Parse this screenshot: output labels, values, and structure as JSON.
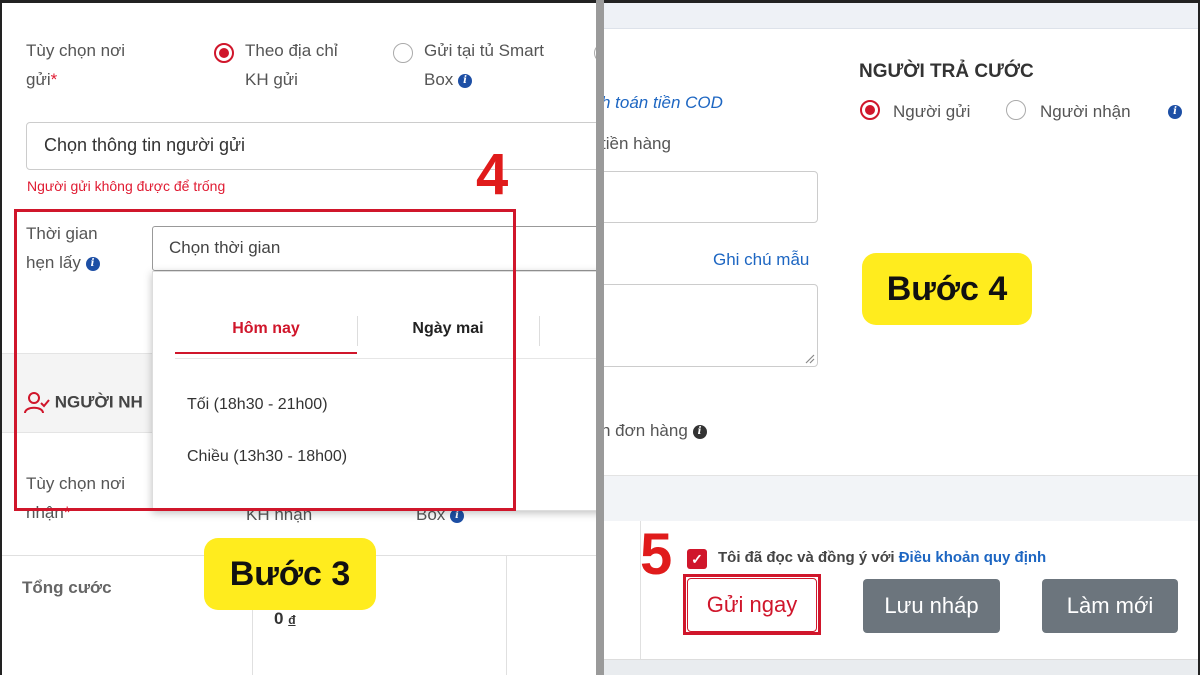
{
  "left": {
    "send_place_label": "Tùy chọn nơi",
    "send_place_label_2": "gửi",
    "required_mark": "*",
    "opt_address_1": "Theo địa chỉ",
    "opt_address_2": "KH gửi",
    "opt_smartbox_1": "Gửi tại tủ Smart",
    "opt_smartbox_2": "Box",
    "sender_placeholder": "Chọn thông tin người gửi",
    "sender_error": "Người gửi không được để trống",
    "pickup_label_1": "Thời gian",
    "pickup_label_2": "hẹn lấy",
    "pickup_select": "Chọn thời gian",
    "dropdown": {
      "tabs": [
        "Hôm nay",
        "Ngày mai"
      ],
      "items": [
        "Tối (18h30 - 21h00)",
        "Chiều (13h30 - 18h00)"
      ]
    },
    "receiver_section": "NGƯỜI NH",
    "recv_place_label_1": "Tùy chọn nơi",
    "recv_place_label_2": "nhận",
    "recv_opt_1": "KH nhận",
    "recv_opt_2": "Box",
    "total_label": "Tổng cước",
    "total_value": "0",
    "currency": "đ",
    "step_number": "4",
    "step_badge": "Bước 3"
  },
  "right": {
    "cod_text": "h toán tiền COD",
    "goods_label": "tiền hàng",
    "payer_title": "NGƯỜI TRẢ CƯỚC",
    "payer_sender": "Người gửi",
    "payer_receiver": "Người nhận",
    "note_template": "Ghi chú mẫu",
    "order_label": "n đơn hàng",
    "agree_text": "Tôi đã đọc và đồng ý với",
    "terms_link": "Điều khoản quy định",
    "send_now": "Gửi ngay",
    "save_draft": "Lưu nháp",
    "reset": "Làm mới",
    "step_number": "5",
    "step_badge": "Bước 4"
  },
  "colors": {
    "brand_red": "#d0162b",
    "highlight_yellow": "#ffec1e",
    "link_blue": "#1d66c2",
    "button_gray": "#6c757d"
  }
}
